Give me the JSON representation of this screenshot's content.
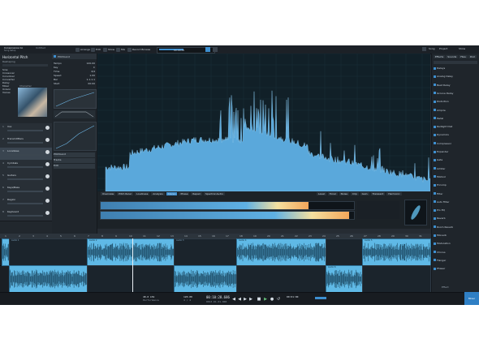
{
  "window": {
    "title": "Consonance Co",
    "subtitle": "Song Setup",
    "song": "Untitled"
  },
  "toolbar": {
    "items": [
      "Arrange",
      "Edit",
      "Show",
      "Mix",
      "Record Browse"
    ],
    "counter_label": "00:00:00",
    "right_items": [
      "Song",
      "Project",
      "Show"
    ]
  },
  "browser": {
    "header": "Horizontal Pitch",
    "subheader": "Reshaping",
    "categories": [
      "Sine",
      "Crossover",
      "Convolver",
      "Converter",
      "Delay",
      "Mixer",
      "Unison",
      "Voices"
    ],
    "tag": "Character"
  },
  "tracks": [
    {
      "num": "1",
      "name": "Vox"
    },
    {
      "num": "2",
      "name": "Transmittters"
    },
    {
      "num": "3",
      "name": "Locallaws"
    },
    {
      "num": "4",
      "name": "Cymbals"
    },
    {
      "num": "5",
      "name": "Guitars"
    },
    {
      "num": "6",
      "name": "Keys/Bass"
    },
    {
      "num": "7",
      "name": "Region"
    },
    {
      "num": "8",
      "name": "Keyboard"
    }
  ],
  "inspector": {
    "title": "Pitchbend",
    "rows": [
      "Tempo",
      "Key",
      "Time",
      "Speed",
      "Bar",
      "Start"
    ],
    "values": [
      "120.00",
      "C",
      "4/4",
      "1.00",
      "1.1.1.1",
      "00:00"
    ],
    "buttons": [
      "Pitchbend",
      "Tracks",
      "Edit"
    ]
  },
  "spectrum_bar": {
    "tabs": [
      "Overview",
      "Pitch Ruler",
      "Loudness",
      "Analysis",
      "Stereo",
      "Phase",
      "Repair",
      "Spectral Audio"
    ],
    "right_tabs": [
      "Level",
      "Tonal",
      "Noise",
      "Clip",
      "Gain",
      "Transient",
      "Harmonic"
    ]
  },
  "meter_values": {
    "loudness_lufs": 0.82,
    "peak": 0.98
  },
  "right_panel": {
    "tabs": [
      "Effects",
      "Sounds",
      "Files",
      "Pool"
    ],
    "items": [
      "Delays",
      "Analog Delay",
      "Beat Delay",
      "Groove Delay",
      "Distortion",
      "Ampire",
      "Pedal",
      "Redlight Dist",
      "Dynamics",
      "Compressor",
      "Expander",
      "Gate",
      "Limiter",
      "Mixtool",
      "Tricomp",
      "Filter",
      "Auto Filter",
      "Pro EQ",
      "Reverb",
      "Room Reverb",
      "Mixverb",
      "Modulation",
      "Chorus",
      "Flanger",
      "Phaser"
    ],
    "footer": "Effect"
  },
  "arranger": {
    "ruler_marks": [
      "1",
      "2",
      "3",
      "4",
      "5",
      "6",
      "7",
      "8",
      "9",
      "10",
      "11",
      "12",
      "13",
      "14",
      "15",
      "16",
      "17",
      "18",
      "19",
      "20",
      "21",
      "22",
      "23",
      "24",
      "25",
      "26",
      "27",
      "28",
      "29",
      "30",
      "31"
    ],
    "clip_labels": [
      "Audio 1",
      "Audio 2",
      "Audio 3",
      "Audio 4",
      "Audio 5",
      "Audio 6"
    ]
  },
  "transport": {
    "sample_rate": "48.0 kHz",
    "time": "00:10:28.686",
    "bars": "0013.01.01.000",
    "tempo": "120.00",
    "signature": "4 / 4",
    "latency": "00:01:00",
    "cpu": "Performance",
    "corner": "Mixer"
  },
  "colors": {
    "accent": "#3d8fd0",
    "clip": "#5fb9e6",
    "meter_hot": "#f2a65a",
    "meter_warm": "#f4e0a0",
    "spectrum_fill": "#5aa8db"
  }
}
